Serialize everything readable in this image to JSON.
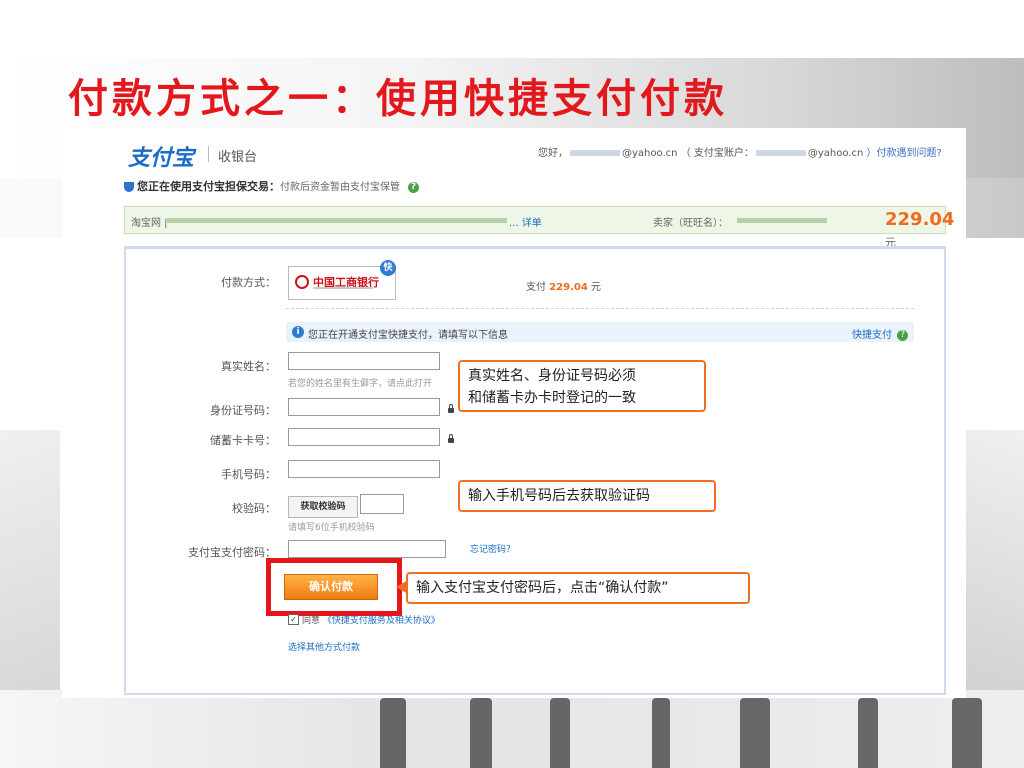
{
  "slide": {
    "title": "付款方式之一：使用快捷支付付款"
  },
  "header": {
    "logo": "支付宝",
    "cashier": "收银台",
    "greeting_prefix": "您好，",
    "greeting_email": "@yahoo.cn",
    "account_label": "（ 支付宝账户：",
    "account_email": "@yahoo.cn",
    "help_link": "）付款遇到问题?"
  },
  "guarantee": {
    "title": "您正在使用支付宝担保交易：",
    "subtitle": "付款后资金暂由支付宝保管"
  },
  "order": {
    "shop": "淘宝网 |",
    "detail_link": "... 详单",
    "seller_label": "卖家（旺旺名）：",
    "amount": "229.04",
    "currency": "元"
  },
  "payment": {
    "method_label": "付款方式：",
    "bank_name": "中国工商银行",
    "quick_badge": "快",
    "pay_prefix": "支付 ",
    "pay_amount": "229.04",
    "pay_suffix": " 元",
    "info_text": "您正在开通支付宝快捷支付，请填写以下信息",
    "quick_link": "快捷支付"
  },
  "form": {
    "name_label": "真实姓名：",
    "name_hint": "若您的姓名里有生僻字，请点此打开",
    "id_label": "身份证号码：",
    "card_label": "储蓄卡卡号：",
    "phone_label": "手机号码：",
    "code_label": "校验码：",
    "get_code_button": "获取校验码",
    "code_hint": "请填写6位手机校验码",
    "password_label": "支付宝支付密码：",
    "forgot_link": "忘记密码？",
    "confirm_button": "确认付款",
    "agree_prefix": "同意",
    "agree_link": "《快捷支付服务及相关协议》",
    "other_link": "选择其他方式付款"
  },
  "callouts": {
    "name_id": [
      "真实姓名、身份证号码必须",
      "和储蓄卡办卡时登记的一致"
    ],
    "phone": "输入手机号码后去获取验证码",
    "password": "输入支付宝支付密码后，点击“确认付款”"
  },
  "colors": {
    "title_red": "#e3181c",
    "callout_orange": "#f07022",
    "amount_orange": "#f26a1b",
    "link_blue": "#1a6cc7"
  }
}
